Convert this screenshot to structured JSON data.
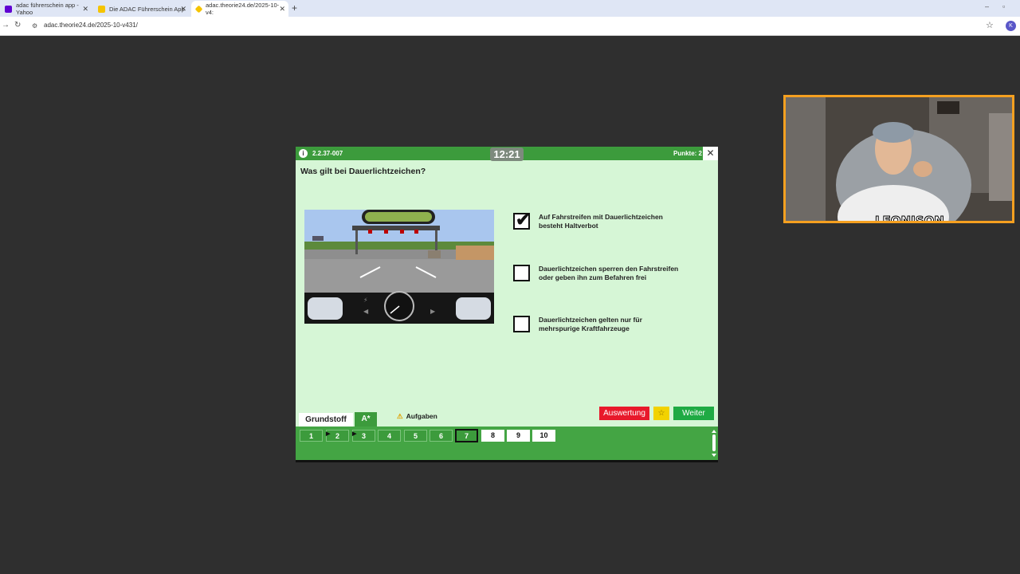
{
  "browser": {
    "tabs": [
      {
        "title": "adac führerschein app - Yahoo",
        "fav_color": "#6001d2",
        "active": false
      },
      {
        "title": "Die ADAC Führerschein App",
        "fav_color": "#f5c400",
        "active": false
      },
      {
        "title": "adac.theorie24.de/2025-10-v4:",
        "fav_color": "#f5c400",
        "active": true
      }
    ],
    "url": "adac.theorie24.de/2025-10-v431/",
    "profile_initial": "K"
  },
  "dialog": {
    "question_id": "2.2.37-007",
    "timer": "12:21",
    "points": "Punkte: 2",
    "question": "Was gilt bei Dauerlichtzeichen?",
    "answers": [
      {
        "text": "Auf Fahrstreifen mit Dauerlichtzeichen besteht Haltverbot",
        "checked": true
      },
      {
        "text": "Dauerlichtzeichen sperren den Fahrstreifen oder geben ihn zum Befahren frei",
        "checked": false
      },
      {
        "text": "Dauerlichtzeichen gelten nur für mehrspurige Kraftfahrzeuge",
        "checked": false
      }
    ],
    "buttons": {
      "evaluate": "Auswertung",
      "favorite": "☆",
      "next": "Weiter"
    },
    "tabs": {
      "basic": "Grundstoff",
      "class": "A*"
    },
    "tasks_label": "Aufgaben",
    "question_numbers": [
      {
        "n": "1",
        "state": "done",
        "flag": false
      },
      {
        "n": "2",
        "state": "done",
        "flag": true
      },
      {
        "n": "3",
        "state": "done",
        "flag": true
      },
      {
        "n": "4",
        "state": "done",
        "flag": false
      },
      {
        "n": "5",
        "state": "done",
        "flag": false
      },
      {
        "n": "6",
        "state": "done",
        "flag": false
      },
      {
        "n": "7",
        "state": "current",
        "flag": false
      },
      {
        "n": "8",
        "state": "open",
        "flag": false
      },
      {
        "n": "9",
        "state": "open",
        "flag": false
      },
      {
        "n": "10",
        "state": "open",
        "flag": false
      }
    ]
  },
  "webcam": {
    "overlay_text": "LEONISON"
  }
}
